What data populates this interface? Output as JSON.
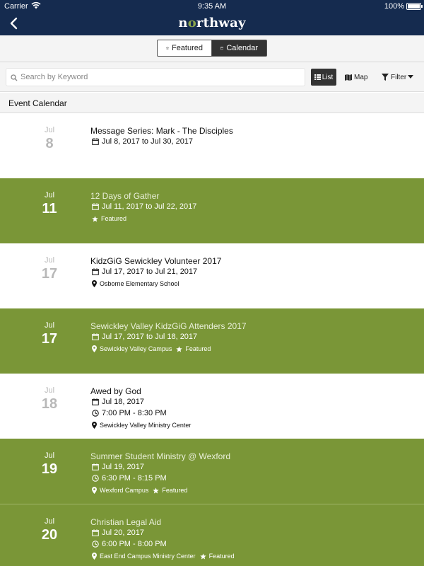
{
  "status_bar": {
    "carrier": "Carrier",
    "time": "9:35 AM",
    "battery": "100%"
  },
  "nav": {
    "logo_pre": "n",
    "logo_o": "o",
    "logo_post": "rthway"
  },
  "segments": {
    "featured": "Featured",
    "calendar": "Calendar",
    "selected": "Calendar"
  },
  "search": {
    "placeholder": "Search by Keyword",
    "value": ""
  },
  "views": {
    "list": "List",
    "map": "Map",
    "filter": "Filter"
  },
  "section": {
    "title": "Event Calendar"
  },
  "events": [
    {
      "month": "Jul",
      "day": "8",
      "title": "Message Series: Mark - The Disciples",
      "date": "Jul 8, 2017 to Jul 30, 2017"
    },
    {
      "month": "Jul",
      "day": "11",
      "title": "12 Days of Gather",
      "date": "Jul 11, 2017 to Jul 22, 2017",
      "featured": "Featured"
    },
    {
      "month": "Jul",
      "day": "17",
      "title": "KidzGiG Sewickley Volunteer 2017",
      "date": "Jul 17, 2017 to Jul 21, 2017",
      "location": "Osborne Elementary School"
    },
    {
      "month": "Jul",
      "day": "17",
      "title": "Sewickley Valley KidzGiG Attenders 2017",
      "date": "Jul 17, 2017 to Jul 18, 2017",
      "location": "Sewickley Valley Campus",
      "featured": "Featured"
    },
    {
      "month": "Jul",
      "day": "18",
      "title": "Awed by God",
      "date": "Jul 18, 2017",
      "time": "7:00 PM - 8:30 PM",
      "location": "Sewickley Valley Ministry Center"
    },
    {
      "month": "Jul",
      "day": "19",
      "title": "Summer Student Ministry @ Wexford",
      "date": "Jul 19, 2017",
      "time": "6:30 PM - 8:15 PM",
      "location": "Wexford Campus",
      "featured": "Featured"
    },
    {
      "month": "Jul",
      "day": "20",
      "title": "Christian Legal Aid",
      "date": "Jul 20, 2017",
      "time": "6:00 PM - 8:00 PM",
      "location": "East End Campus Ministry Center",
      "featured": "Featured"
    }
  ],
  "colors": {
    "nav_bg": "#152b4f",
    "featured_row": "#7a9637",
    "logo_accent": "#8aa54a"
  }
}
